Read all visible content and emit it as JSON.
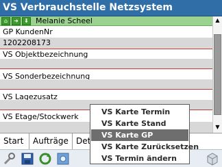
{
  "window": {
    "title": "VS Verbrauchstelle Netzsystem"
  },
  "nav": {
    "customer_name": "Melanie Scheel"
  },
  "fields": [
    {
      "label": "GP KundenNr",
      "value": "1202208173"
    },
    {
      "label": "VS Objektbezeichnung",
      "value": ""
    },
    {
      "label": "VS Sonderbezeichnung",
      "value": ""
    },
    {
      "label": "VS Lagezusatz",
      "value": ""
    },
    {
      "label": "VS Etage/Stockwerk",
      "value": ""
    }
  ],
  "tabs": [
    "Start",
    "Aufträge",
    "Det"
  ],
  "context_menu": {
    "items": [
      "VS Karte Termin",
      "VS Karte Stand",
      "VS Karte GP",
      "VS Karte Zurücksetzen",
      "VS Termin ändern"
    ],
    "selected": "VS Karte GP"
  },
  "toolbar": {
    "icons": [
      "tools-icon",
      "save-icon",
      "refresh-icon",
      "settings-icon",
      "exit-icon"
    ]
  },
  "colors": {
    "title_bar": "#2f6ea6",
    "nav_row": "#9bd28f",
    "field_separator": "#c23b3b",
    "menu_selected": "#6e6e6e"
  }
}
